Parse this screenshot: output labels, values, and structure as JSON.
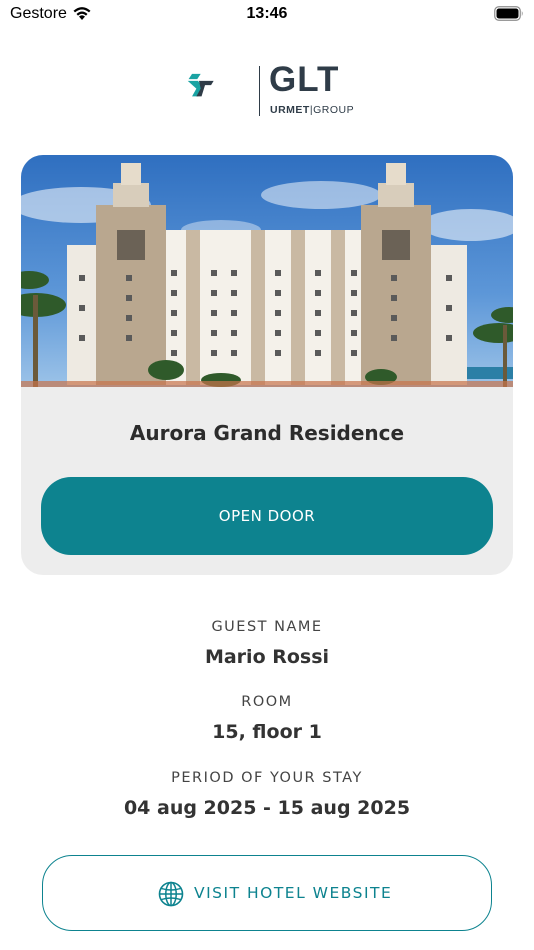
{
  "status_bar": {
    "carrier": "Gestore",
    "time": "13:46"
  },
  "logo": {
    "brand": "GLT",
    "sub_bold": "URMET",
    "sub_light": "GROUP",
    "accent_color": "#1aa3a3",
    "dark_color": "#2f3c48"
  },
  "hotel": {
    "name": "Aurora Grand Residence",
    "open_door_label": "OPEN DOOR"
  },
  "guest": {
    "label": "GUEST NAME",
    "value": "Mario Rossi"
  },
  "room": {
    "label": "ROOM",
    "value": "15, floor 1"
  },
  "stay": {
    "label": "PERIOD OF YOUR STAY",
    "value": "04 aug 2025 - 15 aug 2025"
  },
  "website": {
    "label": "VISIT HOTEL WEBSITE",
    "icon": "globe-icon"
  },
  "colors": {
    "primary": "#0d838f",
    "card_bg": "#ededed"
  }
}
